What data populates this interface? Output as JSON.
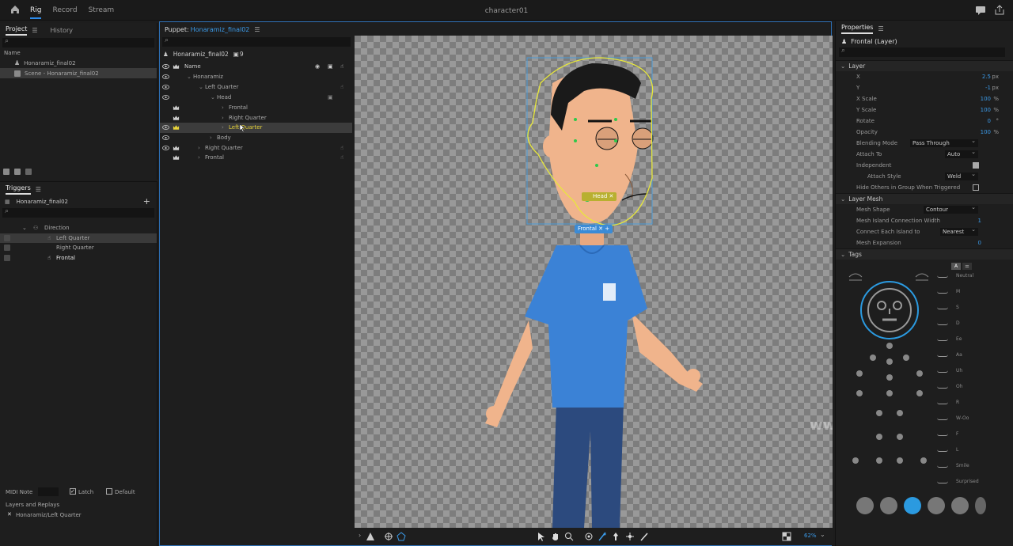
{
  "topbar": {
    "modes": [
      "Rig",
      "Record",
      "Stream"
    ],
    "active_mode": "Rig",
    "title": "character01"
  },
  "project": {
    "tabs": [
      "Project",
      "History"
    ],
    "column": "Name",
    "items": [
      "Honaramiz_final02",
      "Scene - Honaramiz_final02"
    ]
  },
  "triggers": {
    "title": "Triggers",
    "puppet": "Honaramiz_final02",
    "group": "Direction",
    "items": [
      "Left Quarter",
      "Right Quarter",
      "Frontal"
    ],
    "midi_label": "MIDI Note",
    "latch_label": "Latch",
    "default_label": "Default",
    "layers_replays_label": "Layers and Replays",
    "replay_item": "Honaramiz/Left Quarter"
  },
  "puppet": {
    "tab_prefix": "Puppet:",
    "tab_name": "Honaramiz_final02",
    "header_name": "Honaramiz_final02",
    "count": "9",
    "name_col": "Name",
    "layers": [
      "Honaramiz",
      "Left Quarter",
      "Head",
      "Frontal",
      "Right Quarter",
      "Left Quarter",
      "Body",
      "Right Quarter",
      "Frontal"
    ],
    "handle_tags": {
      "head": "Head",
      "frontal": "Frontal"
    },
    "zoom": "62%"
  },
  "properties": {
    "title": "Properties",
    "layer_name": "Frontal (Layer)",
    "sections": {
      "layer": "Layer",
      "mesh": "Layer Mesh",
      "tags": "Tags"
    },
    "layer_props": [
      {
        "label": "X",
        "value": "2.5",
        "unit": "px"
      },
      {
        "label": "Y",
        "value": "-1",
        "unit": "px"
      },
      {
        "label": "X Scale",
        "value": "100",
        "unit": "%"
      },
      {
        "label": "Y Scale",
        "value": "100",
        "unit": "%"
      },
      {
        "label": "Rotate",
        "value": "0",
        "unit": "°"
      },
      {
        "label": "Opacity",
        "value": "100",
        "unit": "%"
      }
    ],
    "blending_label": "Blending Mode",
    "blending_value": "Pass Through",
    "attach_label": "Attach To",
    "attach_value": "Auto",
    "independent_label": "Independent",
    "attach_style_label": "Attach Style",
    "attach_style_value": "Weld",
    "hide_others_label": "Hide Others in Group When Triggered",
    "mesh_shape_label": "Mesh Shape",
    "mesh_shape_value": "Contour",
    "mesh_island_label": "Mesh Island Connection Width",
    "mesh_island_value": "1",
    "connect_label": "Connect Each Island to",
    "connect_value": "Nearest",
    "mesh_exp_label": "Mesh Expansion",
    "mesh_exp_value": "0",
    "tags_button": "A",
    "visemes": [
      "Neutral",
      "M",
      "S",
      "D",
      "Ee",
      "Aa",
      "Uh",
      "Oh",
      "R",
      "W-Oo",
      "F",
      "L",
      "Smile",
      "Surprised"
    ]
  },
  "watermark": "www.honaramiz.com",
  "colors": {
    "accent": "#2d8ceb",
    "value_blue": "#3b9ae8",
    "selection_yellow": "#e8e83a",
    "shirt": "#3b82d6"
  }
}
